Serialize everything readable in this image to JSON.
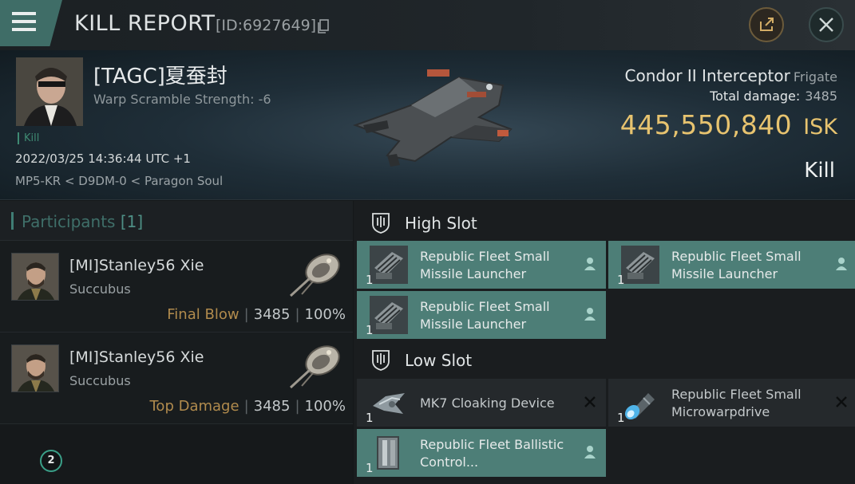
{
  "header": {
    "title": "KILL REPORT",
    "report_id": "[ID:6927649]"
  },
  "victim": {
    "name": "[TAGC]夏蚕封",
    "subtitle": "Warp Scramble Strength: -6",
    "kill_tag": "Kill",
    "timestamp": "2022/03/25 14:36:44 UTC +1",
    "location": "MP5-KR < D9DM-0 < Paragon Soul",
    "ship_name": "Condor II Interceptor",
    "ship_class": "Frigate",
    "total_damage_label": "Total damage:",
    "total_damage": "3485",
    "isk_value": "445,550,840",
    "isk_unit": "ISK",
    "result": "Kill"
  },
  "participants": {
    "title": "Participants",
    "count": "[1]",
    "list": [
      {
        "name": "[MI]Stanley56 Xie",
        "ship": "Succubus",
        "tag": "Final Blow",
        "damage": "3485",
        "percent": "100%"
      },
      {
        "name": "[MI]Stanley56 Xie",
        "ship": "Succubus",
        "tag": "Top Damage",
        "damage": "3485",
        "percent": "100%"
      }
    ],
    "page_badge": "2"
  },
  "fitting": {
    "high_slot_label": "High Slot",
    "low_slot_label": "Low Slot",
    "high": [
      {
        "name": "Republic Fleet Small Missile Launcher",
        "qty": "1",
        "status": "dropped"
      },
      {
        "name": "Republic Fleet Small Missile Launcher",
        "qty": "1",
        "status": "dropped"
      },
      {
        "name": "Republic Fleet Small Missile Launcher",
        "qty": "1",
        "status": "dropped"
      }
    ],
    "low": [
      {
        "name": "MK7 Cloaking Device",
        "qty": "1",
        "status": "destroyed"
      },
      {
        "name": "Republic Fleet Small Microwarpdrive",
        "qty": "1",
        "status": "destroyed"
      },
      {
        "name": "Republic Fleet Ballistic Control...",
        "qty": "1",
        "status": "dropped"
      }
    ]
  },
  "colors": {
    "accent_teal": "#4d7e77",
    "isk_gold": "#e7c36f",
    "final_blow": "#b18b4d"
  }
}
